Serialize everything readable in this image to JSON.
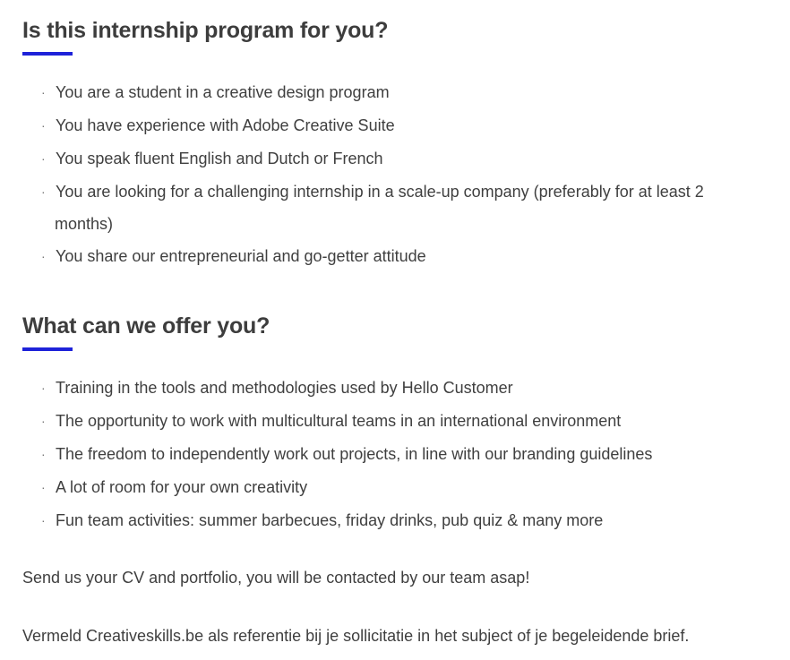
{
  "section1": {
    "title": "Is this internship program for you?",
    "items": [
      "You are a student in a creative design program",
      "You have experience with Adobe Creative Suite",
      "You speak fluent English and Dutch or French",
      "You are looking for a challenging internship in a scale-up company (preferably for at least 2",
      "You share our entrepreneurial and go-getter attitude"
    ],
    "item4_continuation": "months)"
  },
  "section2": {
    "title": "What can we offer you?",
    "items": [
      "Training in the tools and methodologies used by Hello Customer",
      "The opportunity to work with multicultural teams in an international environment",
      "The freedom to independently work out projects, in line with our branding guidelines",
      "A lot of room for your own creativity",
      "Fun team activities: summer barbecues, friday drinks, pub quiz & many more"
    ]
  },
  "paragraphs": {
    "cta": "Send us your CV and portfolio, you will be contacted by our team asap!",
    "reference": "Vermeld Creativeskills.be als referentie bij je sollicitatie in het subject of je begeleidende brief."
  },
  "bullet_glyph": "·",
  "colors": {
    "accent": "#1e22d9",
    "heading": "#3d3d3d",
    "text": "#3f3f3f"
  }
}
